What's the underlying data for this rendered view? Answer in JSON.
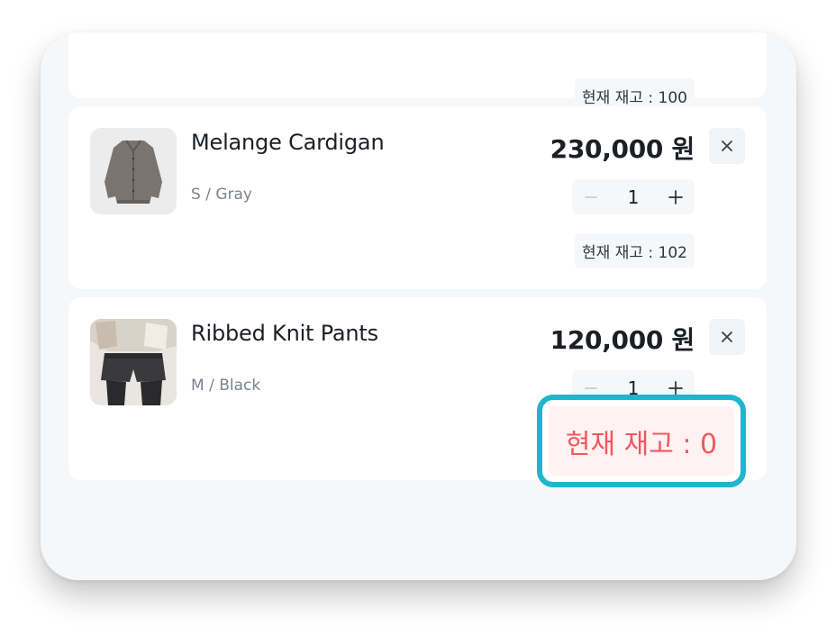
{
  "cart": {
    "top_item": {
      "stock_text": "현재 재고 : 100"
    },
    "items": [
      {
        "name": "Melange Cardigan",
        "option": "S / Gray",
        "price": "230,000 원",
        "quantity": "1",
        "stock_text": "현재 재고 : 102"
      },
      {
        "name": "Ribbed Knit Pants",
        "option": "M / Black",
        "price": "120,000 원",
        "quantity": "1",
        "stock_text": "현재 재고 : 0"
      }
    ]
  },
  "colors": {
    "highlight_border": "#1fb5cf",
    "out_of_stock_text": "#f0585f"
  },
  "icons": {
    "remove": "close-icon",
    "decrease": "minus-icon",
    "increase": "plus-icon"
  }
}
